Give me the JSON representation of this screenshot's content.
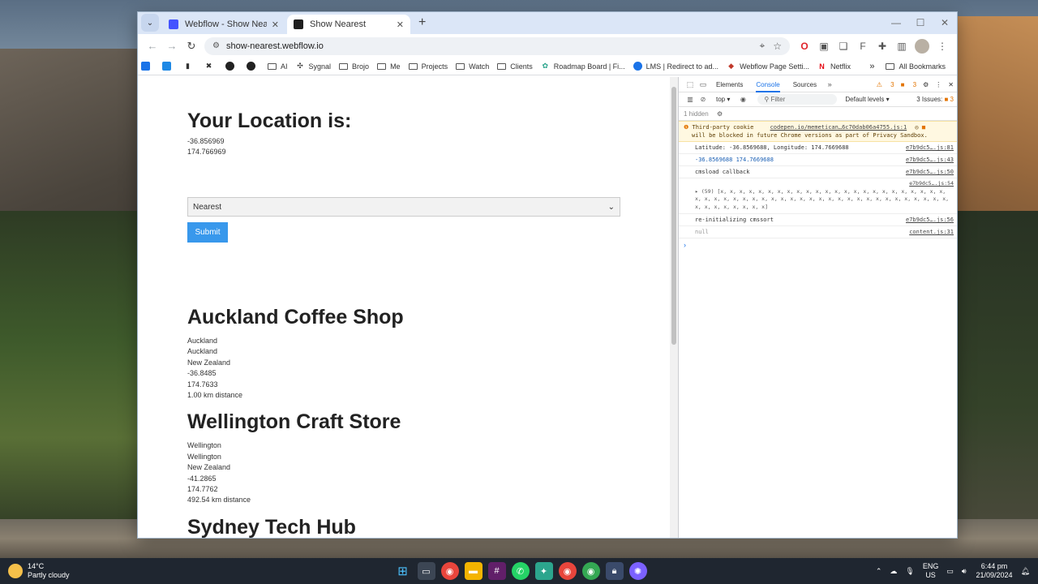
{
  "browser": {
    "tabs": [
      {
        "title": "Webflow - Show Nearest",
        "active": false
      },
      {
        "title": "Show Nearest",
        "active": true
      }
    ],
    "url": "show-nearest.webflow.io",
    "bookmarks": [
      "AI",
      "Sygnal",
      "Brojo",
      "Me",
      "Projects",
      "Watch",
      "Clients",
      "Roadmap Board | Fi...",
      "LMS | Redirect to ad...",
      "Webflow Page Setti...",
      "Netflix"
    ],
    "all_bookmarks": "All Bookmarks"
  },
  "page": {
    "heading": "Your Location is:",
    "lat": "-36.856969",
    "lng": "174.766969",
    "select_value": "Nearest",
    "submit_label": "Submit",
    "stores": [
      {
        "name": "Auckland Coffee Shop",
        "lines": [
          "Auckland",
          "Auckland",
          "New Zealand",
          "-36.8485",
          "174.7633",
          "1.00 km distance"
        ]
      },
      {
        "name": "Wellington Craft Store",
        "lines": [
          "Wellington",
          "Wellington",
          "New Zealand",
          "-41.2865",
          "174.7762",
          "492.54 km distance"
        ]
      },
      {
        "name": "Sydney Tech Hub"
      }
    ]
  },
  "devtools": {
    "tabs": [
      "Elements",
      "Console",
      "Sources"
    ],
    "active_tab": "Console",
    "warnings": "3",
    "errors": "3",
    "context": "top",
    "filter_placeholder": "Filter",
    "levels": "Default levels",
    "issues": "3 Issues:",
    "issues_count": "3",
    "hidden": "1 hidden",
    "console": {
      "cookie_warning_1": "Third-party cookie",
      "cookie_link": "codepen.io/memetican…6c70dab06a4755.js:1",
      "cookie_warning_2": "will be blocked in future Chrome versions as part of Privacy Sandbox.",
      "line1": "Latitude: -36.8569688, Longitude: 174.7669688",
      "line1_src": "e7b9dc5….js:81",
      "line2": "-36.8569688 174.7669688",
      "line2_src": "e7b9dc5….js:43",
      "line3": "cmsload callback",
      "line3_src": "e7b9dc5….js:50",
      "line4_src": "e7b9dc5….js:54",
      "array_text": "▸ (59) [x, x, x, x, x, x, x, x, x, x, x, x, x, x, x, x, x, x, x, x, x, x, x, x, x, x, x, x, x, x, x, x, x, x, x, x, x, x, x, x, x, x, x, x, x, x, x, x, x, x, x, x, x, x, x, x, x, x, x]",
      "line5": "re-initializing cmssort",
      "line5_src": "e7b9dc5….js:56",
      "line6": "null",
      "line6_src": "content.js:31"
    }
  },
  "taskbar": {
    "temp": "14°C",
    "weather": "Partly cloudy",
    "lang1": "ENG",
    "lang2": "US",
    "time": "6:44 pm",
    "date": "21/09/2024"
  }
}
